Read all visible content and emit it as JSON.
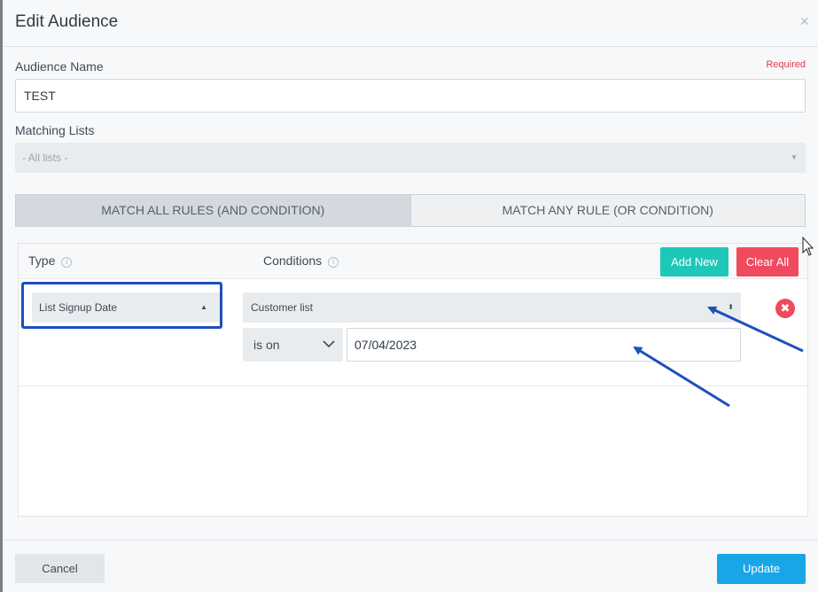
{
  "modal": {
    "title": "Edit Audience",
    "close_glyph": "×"
  },
  "form": {
    "audience_name_label": "Audience Name",
    "required_label": "Required",
    "audience_name_value": "TEST",
    "matching_lists_label": "Matching Lists",
    "matching_lists_value": "- All lists -"
  },
  "match_mode": {
    "all_label": "MATCH ALL RULES (AND CONDITION)",
    "any_label": "MATCH ANY RULE (OR CONDITION)",
    "selected": "all"
  },
  "rules_table": {
    "type_header": "Type",
    "conditions_header": "Conditions",
    "info_glyph": "i",
    "add_new_label": "Add New",
    "clear_all_label": "Clear All",
    "rows": [
      {
        "type": "List Signup Date",
        "condition_list": "Customer list",
        "operator": "is on",
        "date_value": "07/04/2023",
        "remove_glyph": "✖"
      }
    ]
  },
  "footer": {
    "cancel_label": "Cancel",
    "update_label": "Update"
  },
  "colors": {
    "accent_blue": "#19a6e8",
    "add_green": "#1ec8b8",
    "clear_red": "#ef4a5e",
    "annotation_blue": "#1d4fbd"
  },
  "icons": {
    "close": "close-icon",
    "info": "info-icon",
    "caret": "caret-icon",
    "chevron": "chevron-down-icon",
    "remove": "remove-rule-icon",
    "cursor": "mouse-cursor-icon"
  }
}
